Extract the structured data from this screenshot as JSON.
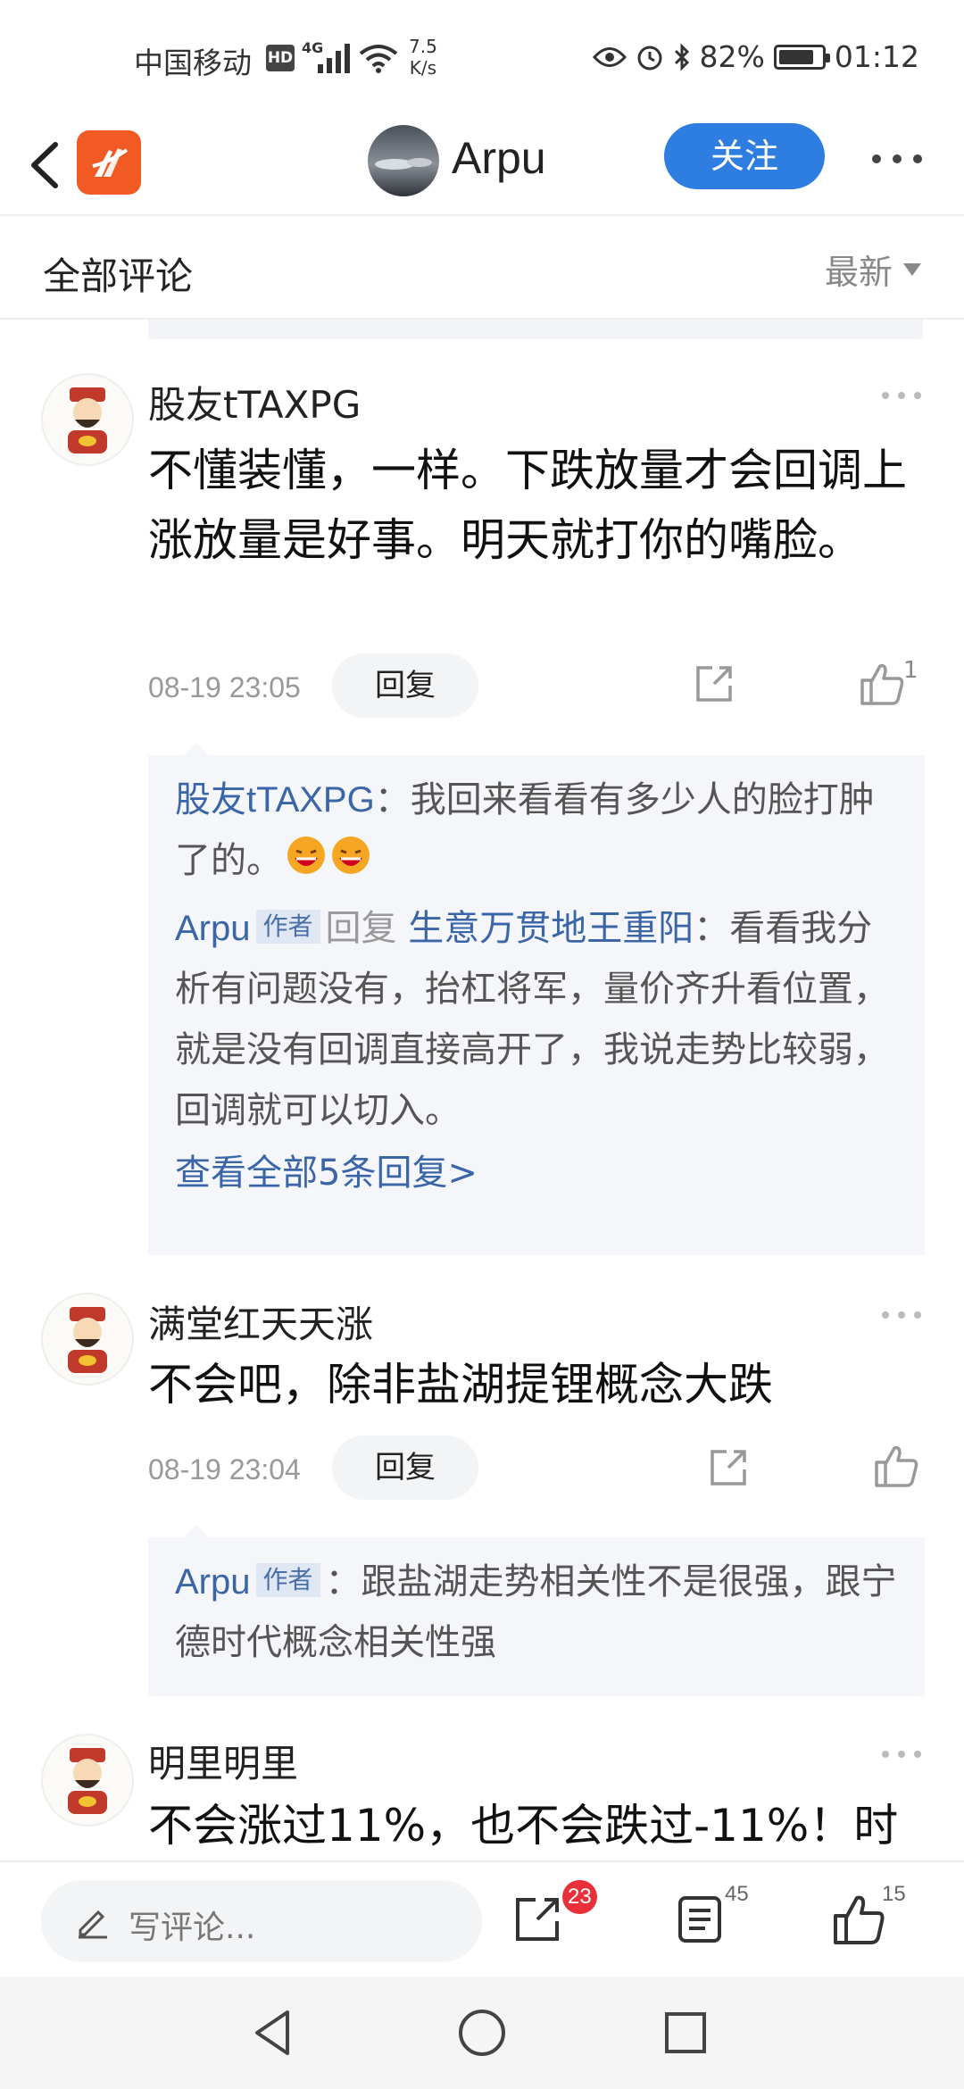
{
  "status_bar": {
    "carrier": "中国移动",
    "hd": "HD",
    "network": "4G",
    "speed_value": "7.5",
    "speed_unit": "K/s",
    "battery_percent": "82%",
    "battery_level": 0.82,
    "time": "01:12"
  },
  "header": {
    "name": "Arpu",
    "follow_label": "关注"
  },
  "sort_bar": {
    "title": "全部评论",
    "sort_value": "最新"
  },
  "comments": [
    {
      "author": "股友tTAXPG",
      "text": "不懂装懂，一样。下跌放量才会回调上涨放量是好事。明天就打你的嘴脸。",
      "time": "08-19 23:05",
      "reply_label": "回复",
      "like_count": "1",
      "replies": [
        {
          "name": "股友tTAXPG",
          "text": "：我回来看看有多少人的脸打肿了的。"
        },
        {
          "name": "Arpu",
          "author_tag": "作者",
          "reply_word": "回复",
          "target": "生意万贯地王重阳",
          "text": "：看看我分析有问题没有，抬杠将军，量价齐升看位置，就是没有回调直接高开了，我说走势比较弱，回调就可以切入。"
        }
      ],
      "view_all": "查看全部5条回复>"
    },
    {
      "author": "满堂红天天涨",
      "text": "不会吧，除非盐湖提锂概念大跌",
      "time": "08-19 23:04",
      "reply_label": "回复",
      "like_count": "",
      "replies": [
        {
          "name": "Arpu",
          "author_tag": "作者",
          "text": "：跟盐湖走势相关性不是很强，跟宁德时代概念相关性强"
        }
      ]
    },
    {
      "author": "明里明里",
      "text": "不会涨过11%，也不会跌过-11%！时"
    }
  ],
  "bottom_bar": {
    "placeholder": "写评论...",
    "share_badge": "23",
    "comments_count": "45",
    "likes_count": "15"
  }
}
